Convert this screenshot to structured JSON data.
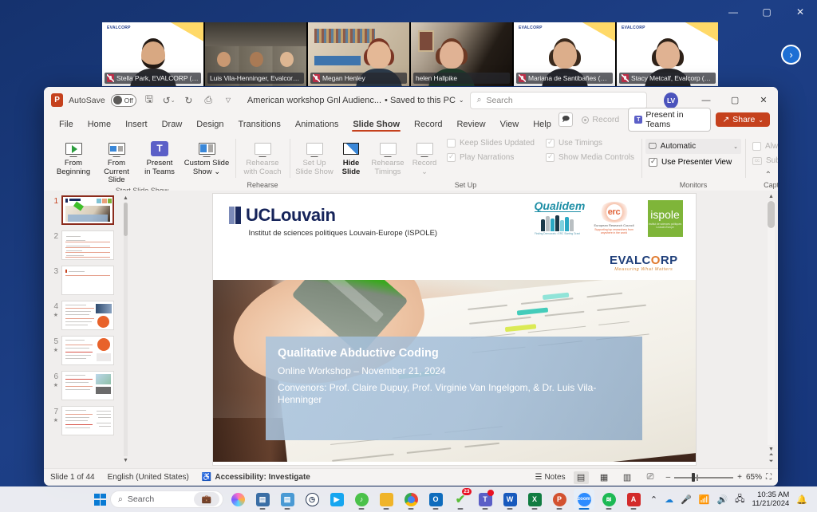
{
  "desktop": {
    "window_controls": {
      "minimize": "—",
      "maximize": "▢",
      "close": "✕"
    },
    "next_arrow": "›"
  },
  "teams": {
    "participants": [
      {
        "name": "Stella Park, EVALCORP (she/...",
        "muted": true,
        "active": false,
        "bg": "#ffffff",
        "skin": "#d8a882",
        "hair": "#231a14",
        "shirt": "#2a2a2e",
        "corp": "EVALCORP"
      },
      {
        "name": "Luis Vila-Henninger, Evalcorp (h...",
        "muted": false,
        "active": true,
        "bg": "#6b6459",
        "skin": "#c99872",
        "hair": "#2b2119",
        "shirt": "#1d2433",
        "corp": ""
      },
      {
        "name": "Megan Henley",
        "muted": true,
        "active": false,
        "bg": "#d9cdbb",
        "skin": "#e4b896",
        "hair": "#7a3524",
        "shirt": "#2c3a4a",
        "corp": ""
      },
      {
        "name": "helen Hallpike",
        "muted": false,
        "active": false,
        "bg": "#2c2622",
        "skin": "#e0b294",
        "hair": "#6d3a25",
        "shirt": "#1f3a2a",
        "corp": ""
      },
      {
        "name": "Mariana de Santibañes (She/...",
        "muted": true,
        "active": false,
        "bg": "#ffffff",
        "skin": "#dcae8b",
        "hair": "#3b2a1d",
        "shirt": "#232329",
        "corp": "EVALCORP"
      },
      {
        "name": "Stacy Metcalf, Evalcorp (she/...",
        "muted": true,
        "active": false,
        "bg": "#ffffff",
        "skin": "#e0b292",
        "hair": "#2e2118",
        "shirt": "#242428",
        "corp": "EVALCORP"
      }
    ]
  },
  "powerpoint": {
    "app_badge": "P",
    "autosave_label": "AutoSave",
    "autosave_state": "Off",
    "quick_access": [
      "save-icon",
      "undo-icon",
      "redo-icon",
      "present-icon",
      "customize-icon"
    ],
    "document_title": "American workshop Gnl Audienc...",
    "save_status": "• Saved to this PC",
    "search_placeholder": "Search",
    "account_initials": "LV",
    "window_controls": {
      "minimize": "—",
      "restore": "▢",
      "close": "✕"
    },
    "tabs": [
      {
        "label": "File",
        "active": false
      },
      {
        "label": "Home",
        "active": false
      },
      {
        "label": "Insert",
        "active": false
      },
      {
        "label": "Draw",
        "active": false
      },
      {
        "label": "Design",
        "active": false
      },
      {
        "label": "Transitions",
        "active": false
      },
      {
        "label": "Animations",
        "active": false
      },
      {
        "label": "Slide Show",
        "active": true
      },
      {
        "label": "Record",
        "active": false
      },
      {
        "label": "Review",
        "active": false
      },
      {
        "label": "View",
        "active": false
      },
      {
        "label": "Help",
        "active": false
      }
    ],
    "tab_right": {
      "comments_icon": "comment-icon",
      "record_label": "Record",
      "present_in_teams_label": "Present in Teams",
      "share_label": "Share",
      "share_caret": "⌄"
    },
    "ribbon": {
      "groups": [
        {
          "label": "Start Slide Show",
          "buttons": [
            {
              "label": "From\nBeginning",
              "line1": "From",
              "line2": "Beginning",
              "disabled": false,
              "bold": false,
              "icon": "from-beginning-icon"
            },
            {
              "label": "From\nCurrent Slide",
              "line1": "From",
              "line2": "Current Slide",
              "disabled": false,
              "bold": false,
              "icon": "from-current-slide-icon"
            },
            {
              "line1": "Present",
              "line2": "in Teams",
              "disabled": false,
              "bold": false,
              "icon": "present-in-teams-icon"
            },
            {
              "line1": "Custom Slide",
              "line2": "Show ⌄",
              "disabled": false,
              "bold": false,
              "icon": "custom-slide-show-icon"
            }
          ]
        },
        {
          "label": "Rehearse",
          "buttons": [
            {
              "line1": "Rehearse",
              "line2": "with Coach",
              "disabled": true,
              "bold": false,
              "icon": "rehearse-with-coach-icon"
            }
          ]
        },
        {
          "label": "Set Up",
          "buttons": [
            {
              "line1": "Set Up",
              "line2": "Slide Show",
              "disabled": true,
              "bold": false,
              "icon": "set-up-slide-show-icon"
            },
            {
              "line1": "Hide",
              "line2": "Slide",
              "disabled": false,
              "bold": true,
              "icon": "hide-slide-icon"
            },
            {
              "line1": "Rehearse",
              "line2": "Timings",
              "disabled": true,
              "bold": false,
              "icon": "rehearse-timings-icon"
            },
            {
              "line1": "Record",
              "line2": "⌄",
              "disabled": true,
              "bold": false,
              "icon": "record-icon"
            }
          ],
          "checkboxes": [
            {
              "label": "Keep Slides Updated",
              "checked": false,
              "disabled": true
            },
            {
              "label": "Play Narrations",
              "checked": true,
              "disabled": true
            },
            {
              "label": "Use Timings",
              "checked": true,
              "disabled": true
            },
            {
              "label": "Show Media Controls",
              "checked": true,
              "disabled": true
            }
          ]
        },
        {
          "label": "Monitors",
          "monitor_value": "Automatic",
          "presenter_view_label": "Use Presenter View",
          "presenter_view_checked": true
        },
        {
          "label": "Captions & Subtitles",
          "always_subtitles_label": "Always Use Subtitles",
          "always_subtitles_checked": false,
          "subtitle_settings_label": "Subtitle Settings ⌄"
        }
      ],
      "collapse_icon": "⌃"
    },
    "thumbnails": [
      {
        "number": "1",
        "selected": true,
        "animated": false
      },
      {
        "number": "2",
        "selected": false,
        "animated": false
      },
      {
        "number": "3",
        "selected": false,
        "animated": false
      },
      {
        "number": "4",
        "selected": false,
        "animated": true
      },
      {
        "number": "5",
        "selected": false,
        "animated": true
      },
      {
        "number": "6",
        "selected": false,
        "animated": true
      },
      {
        "number": "7",
        "selected": false,
        "animated": true
      }
    ],
    "slide": {
      "institution": "UCLouvain",
      "institute_line": "Institut de sciences politiques Louvain-Europe (ISPOLE)",
      "logos": {
        "qualidem": "Qualidem",
        "qualidem_tagline": "Finding Democrats • ERC Starting Grant",
        "erc": "erc",
        "erc_sub": "European Research Council",
        "erc_tagline": "Supporting top researchers from anywhere in the world",
        "ispole": "ispole",
        "ispole_sub": "Institut de sciences politiques Louvain-Europe",
        "evalcorp": "EVALCORP",
        "evalcorp_tagline": "Measuring What Matters"
      },
      "title": "Qualitative Abductive Coding",
      "subtitle": "Online Workshop – November 21, 2024",
      "convenors": "Convenors: Prof. Claire Dupuy, Prof. Virginie Van Ingelgom, & Dr. Luis Vila-Henninger"
    },
    "statusbar": {
      "slide_count": "Slide 1 of 44",
      "language": "English (United States)",
      "accessibility": "Accessibility: Investigate",
      "notes_label": "Notes",
      "views": [
        "normal-view-icon",
        "slide-sorter-icon",
        "reading-view-icon",
        "slide-show-icon"
      ],
      "zoom_minus": "–",
      "zoom_plus": "+",
      "zoom_level": "65%",
      "fit_icon": "fit-slide-icon"
    }
  },
  "taskbar": {
    "start_label": "start-button",
    "search_placeholder": "Search",
    "apps": [
      {
        "name": "copilot",
        "glyph": "",
        "color": "#e85aa0",
        "running": false,
        "active": false
      },
      {
        "name": "calculator",
        "glyph": "",
        "color": "#3a6ea5",
        "running": true,
        "active": false
      },
      {
        "name": "notepad",
        "glyph": "",
        "color": "#4a9ad4",
        "running": true,
        "active": false
      },
      {
        "name": "clock",
        "glyph": "",
        "color": "#2b3a55",
        "running": false,
        "active": false
      },
      {
        "name": "powertoys",
        "glyph": "▶",
        "color": "#16a6f0",
        "running": false,
        "active": false
      },
      {
        "name": "spotify-alt",
        "glyph": "♪",
        "color": "#4ac14a",
        "running": true,
        "active": false
      },
      {
        "name": "file-explorer",
        "glyph": "",
        "color": "#f0b429",
        "running": true,
        "active": false
      },
      {
        "name": "chrome",
        "glyph": "",
        "color": "#4285f4",
        "running": true,
        "active": false
      },
      {
        "name": "outlook",
        "glyph": "O",
        "color": "#0f6cbd",
        "running": true,
        "active": false
      },
      {
        "name": "antivirus",
        "glyph": "✓",
        "color": "#5bbd3a",
        "running": true,
        "active": false,
        "badge": "23"
      },
      {
        "name": "teams",
        "glyph": "T",
        "color": "#5b5fc7",
        "running": true,
        "active": false
      },
      {
        "name": "word",
        "glyph": "W",
        "color": "#185abd",
        "running": true,
        "active": false
      },
      {
        "name": "excel",
        "glyph": "X",
        "color": "#107c41",
        "running": true,
        "active": false
      },
      {
        "name": "powerpoint",
        "glyph": "P",
        "color": "#c5411d",
        "running": true,
        "active": false
      },
      {
        "name": "zoom",
        "glyph": "",
        "color": "#2d8cff",
        "running": true,
        "active": true
      },
      {
        "name": "spotify",
        "glyph": "",
        "color": "#1db954",
        "running": true,
        "active": false
      },
      {
        "name": "acrobat",
        "glyph": "A",
        "color": "#d32b2b",
        "running": true,
        "active": false
      }
    ],
    "tray": {
      "chevron": "⌃",
      "onedrive": "onedrive-icon",
      "mic": "mic-icon",
      "wifi": "wifi-icon",
      "volume": "volume-icon",
      "vpn": "vpn-icon",
      "time": "10:35 AM",
      "date": "11/21/2024",
      "notifications": "bell-icon"
    }
  }
}
